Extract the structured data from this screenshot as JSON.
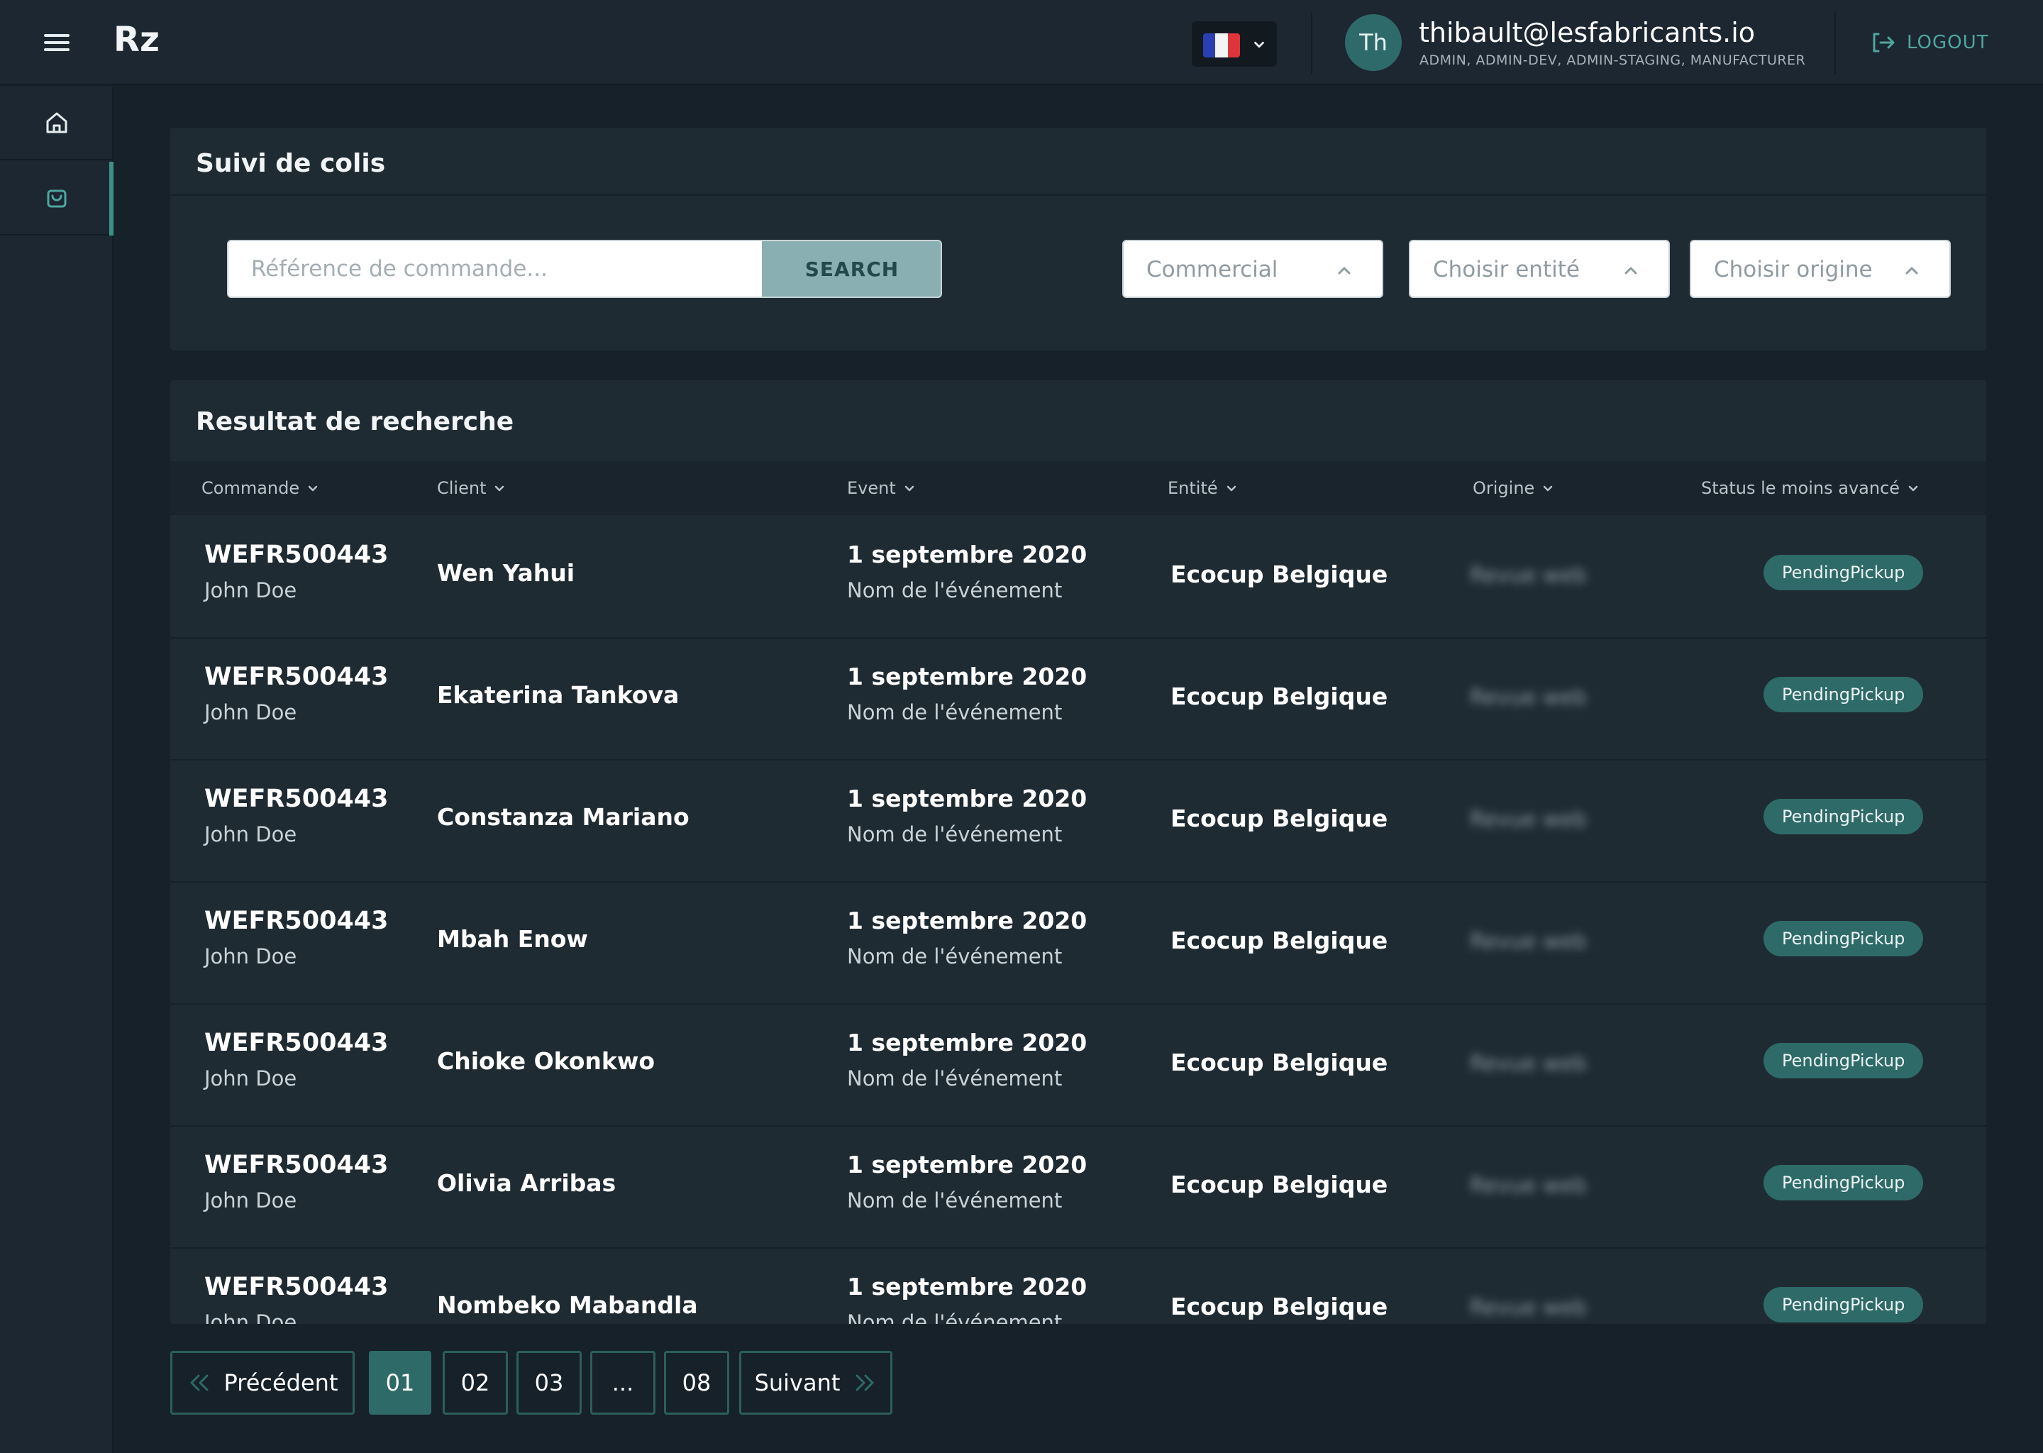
{
  "app": {
    "brand": "Rz",
    "language_flag": "flag-france-icon"
  },
  "user": {
    "initials": "Th",
    "email": "thibault@lesfabricants.io",
    "roles": "ADMIN, ADMIN-DEV, ADMIN-STAGING, MANUFACTURER"
  },
  "logout_label": "LOGOUT",
  "search_panel": {
    "title": "Suivi de colis",
    "search_placeholder": "Référence de commande...",
    "search_button": "SEARCH",
    "filters": [
      "Commercial",
      "Choisir entité",
      "Choisir origine"
    ]
  },
  "results": {
    "title": "Resultat de recherche",
    "columns": [
      "Commande",
      "Client",
      "Event",
      "Entité",
      "Origine",
      "Status le moins avancé"
    ],
    "rows": [
      {
        "order": "WEFR500443",
        "person": "John Doe",
        "client": "Wen Yahui",
        "event_date": "1 septembre 2020",
        "event_name": "Nom de l'événement",
        "entity": "Ecocup Belgique",
        "origin": "Revue web",
        "status": "PendingPickup"
      },
      {
        "order": "WEFR500443",
        "person": "John Doe",
        "client": "Ekaterina Tankova",
        "event_date": "1 septembre 2020",
        "event_name": "Nom de l'événement",
        "entity": "Ecocup Belgique",
        "origin": "Revue web",
        "status": "PendingPickup"
      },
      {
        "order": "WEFR500443",
        "person": "John Doe",
        "client": "Constanza Mariano",
        "event_date": "1 septembre 2020",
        "event_name": "Nom de l'événement",
        "entity": "Ecocup Belgique",
        "origin": "Revue web",
        "status": "PendingPickup"
      },
      {
        "order": "WEFR500443",
        "person": "John Doe",
        "client": "Mbah Enow",
        "event_date": "1 septembre 2020",
        "event_name": "Nom de l'événement",
        "entity": "Ecocup Belgique",
        "origin": "Revue web",
        "status": "PendingPickup"
      },
      {
        "order": "WEFR500443",
        "person": "John Doe",
        "client": "Chioke Okonkwo",
        "event_date": "1 septembre 2020",
        "event_name": "Nom de l'événement",
        "entity": "Ecocup Belgique",
        "origin": "Revue web",
        "status": "PendingPickup"
      },
      {
        "order": "WEFR500443",
        "person": "John Doe",
        "client": "Olivia Arribas",
        "event_date": "1 septembre 2020",
        "event_name": "Nom de l'événement",
        "entity": "Ecocup Belgique",
        "origin": "Revue web",
        "status": "PendingPickup"
      },
      {
        "order": "WEFR500443",
        "person": "John Doe",
        "client": "Nombeko Mabandla",
        "event_date": "1 septembre 2020",
        "event_name": "Nom de l'événement",
        "entity": "Ecocup Belgique",
        "origin": "Revue web",
        "status": "PendingPickup"
      }
    ]
  },
  "pagination": {
    "previous": "Précédent",
    "next": "Suivant",
    "pages": [
      "01",
      "02",
      "03",
      "...",
      "08"
    ],
    "current": "01"
  },
  "colors": {
    "accent": "#2e6a68",
    "accent_text": "#4fa6a0",
    "background": "#16212a",
    "panel": "#1f2b33"
  }
}
